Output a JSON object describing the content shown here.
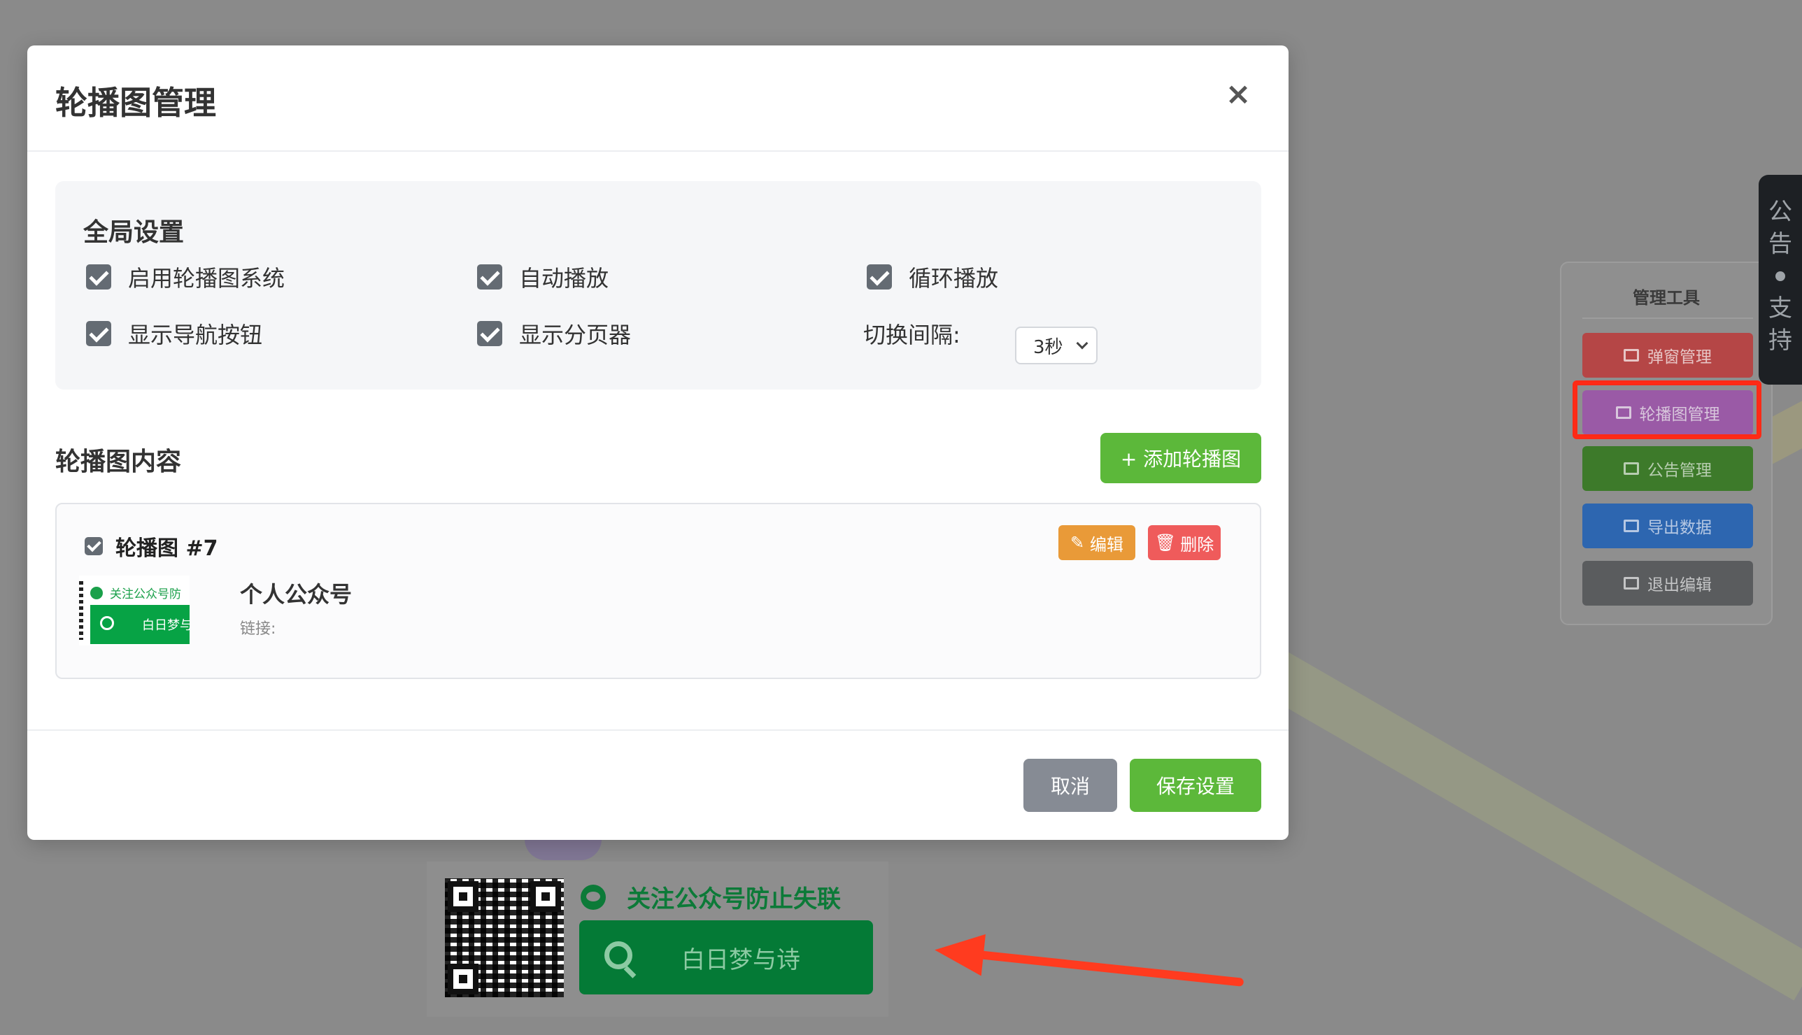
{
  "modal": {
    "title": "轮播图管理",
    "close": "×",
    "global": {
      "title": "全局设置",
      "options": [
        {
          "label": "启用轮播图系统",
          "checked": true
        },
        {
          "label": "自动播放",
          "checked": true
        },
        {
          "label": "循环播放",
          "checked": true
        },
        {
          "label": "显示导航按钮",
          "checked": true
        },
        {
          "label": "显示分页器",
          "checked": true
        }
      ],
      "interval_label": "切换间隔:",
      "interval_value": "3秒"
    },
    "content": {
      "title": "轮播图内容",
      "add_label": "+ 添加轮播图",
      "slide": {
        "title": "轮播图 #7",
        "edit_label": "编辑",
        "delete_label": "删除",
        "name": "个人公众号",
        "link_label": "链接:",
        "thumb_top": "关注公众号防",
        "thumb_bar": "白日梦与"
      }
    },
    "footer": {
      "cancel_label": "取消",
      "save_label": "保存设置"
    }
  },
  "promo": {
    "top_text": "关注公众号防止失联",
    "bar_text": "白日梦与诗"
  },
  "tools": {
    "title": "管理工具",
    "items": [
      "弹窗管理",
      "轮播图管理",
      "公告管理",
      "导出数据",
      "退出编辑"
    ]
  },
  "side_tab": {
    "chars": [
      "公",
      "告",
      "支",
      "持"
    ]
  },
  "colors": {
    "accent_green": "#5cb83a",
    "edit_orange": "#e99a38",
    "delete_red": "#ef5b5b",
    "highlight_red": "#ff2a16"
  }
}
